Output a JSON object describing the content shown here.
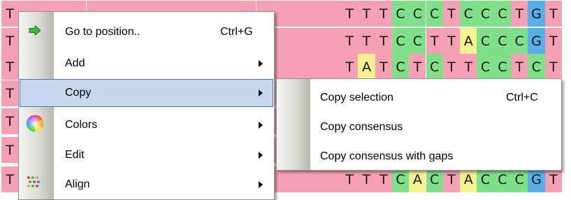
{
  "sequence_grid": {
    "rows": [
      "T???????????????????TTTCCCTCCCTGT",
      "T???????????????????TTTCCTTACCCGT",
      "T???????????????????TATCTCTTCCTCT",
      "T????????????????????????????????",
      "T????????????????????????????????",
      "T????????????????????????????????",
      "T???????????????????TTTCACTACCCGT"
    ],
    "hidden_mask_char": "?",
    "colors": {
      "T": "#f5a0b4",
      "C": "#7fe08a",
      "A": "#f7f290",
      "G": "#5aaee6"
    }
  },
  "context_menu": {
    "items": [
      {
        "label": "Go to position..",
        "shortcut": "Ctrl+G",
        "icon": "green-arrow-icon",
        "has_submenu": false,
        "highlighted": false
      },
      {
        "label": "Add",
        "shortcut": "",
        "icon": "",
        "has_submenu": true,
        "highlighted": false
      },
      {
        "label": "Copy",
        "shortcut": "",
        "icon": "",
        "has_submenu": true,
        "highlighted": true
      },
      {
        "label": "Colors",
        "shortcut": "",
        "icon": "color-wheel-icon",
        "has_submenu": true,
        "highlighted": false
      },
      {
        "label": "Edit",
        "shortcut": "",
        "icon": "",
        "has_submenu": true,
        "highlighted": false
      },
      {
        "label": "Align",
        "shortcut": "",
        "icon": "align-icon",
        "has_submenu": true,
        "highlighted": false
      }
    ]
  },
  "copy_submenu": {
    "items": [
      {
        "label": "Copy selection",
        "shortcut": "Ctrl+C"
      },
      {
        "label": "Copy consensus",
        "shortcut": ""
      },
      {
        "label": "Copy consensus with gaps",
        "shortcut": ""
      }
    ]
  }
}
